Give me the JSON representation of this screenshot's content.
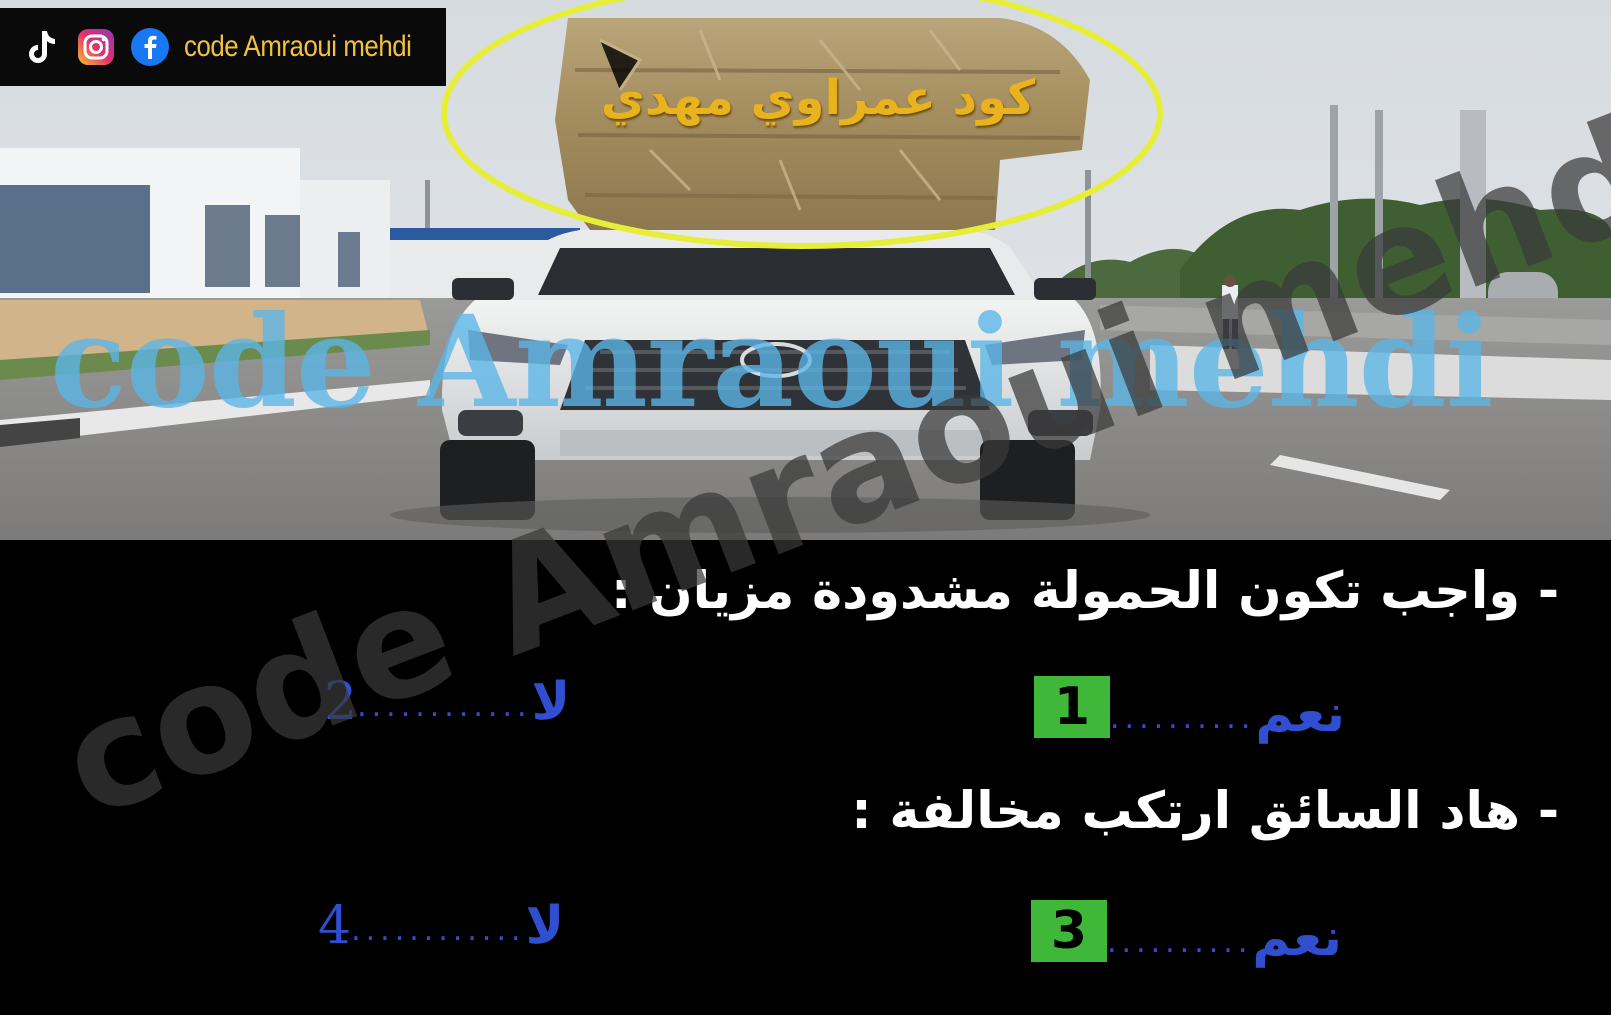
{
  "brand": {
    "name": "code Amraoui mehdi",
    "icons": [
      "tiktok-icon",
      "instagram-icon",
      "facebook-icon"
    ],
    "tiktok_caption": "TikTok"
  },
  "cargo_overlay_text": "كود عمراوي مهدي",
  "watermarks": {
    "horizontal": "code Amraoui mehdi",
    "diagonal": "code Amraoui mehdi"
  },
  "questions": [
    {
      "text": "- واجب تكون الحمولة مشدودة مزيان :",
      "options": [
        {
          "word": "نعم",
          "dots": "..........",
          "number": "1",
          "selected": true
        },
        {
          "word": "لا",
          "dots": "............",
          "number": "2",
          "selected": false
        }
      ]
    },
    {
      "text": "- هاد السائق ارتكب مخالفة :",
      "options": [
        {
          "word": "نعم",
          "dots": "..........",
          "number": "3",
          "selected": true
        },
        {
          "word": "لا",
          "dots": "............",
          "number": "4",
          "selected": false
        }
      ]
    }
  ],
  "colors": {
    "answer_blue": "#2f4fd0",
    "selected_box_green": "#3fb83a",
    "brand_gold": "#f2c23c",
    "highlight_ellipse": "#e6ee3a",
    "watermark_blue": "#5bb6e8"
  }
}
